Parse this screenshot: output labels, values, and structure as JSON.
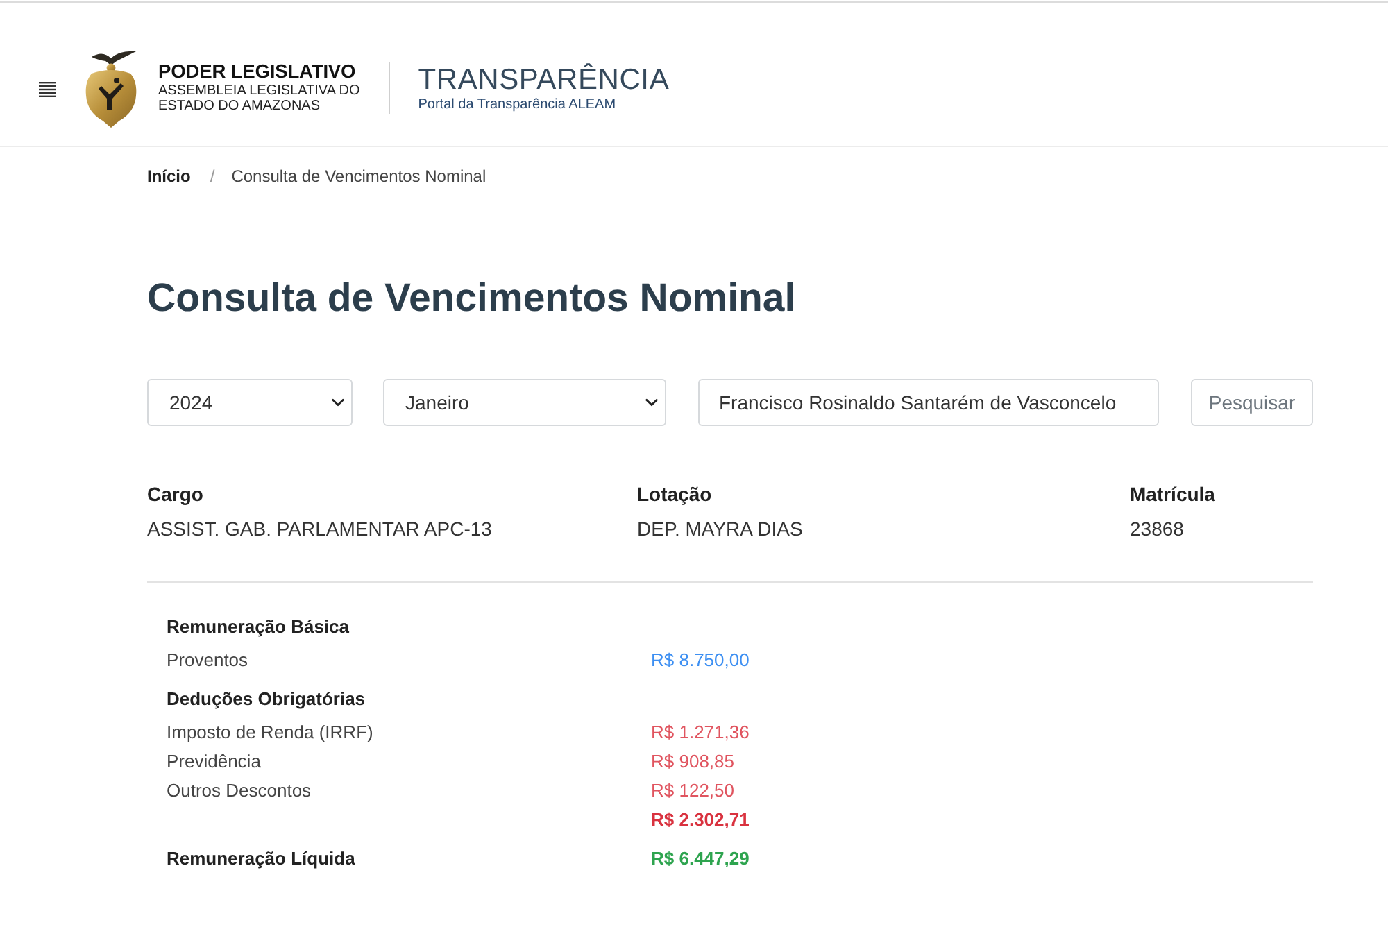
{
  "header": {
    "brand": {
      "title": "PODER LEGISLATIVO",
      "subtitle_lines": [
        "ASSEMBLEIA LEGISLATIVA DO",
        "ESTADO DO AMAZONAS"
      ]
    },
    "portal": {
      "title": "TRANSPARÊNCIA",
      "subtitle": "Portal da Transparência ALEAM"
    }
  },
  "breadcrumb": {
    "separator": "/",
    "items": [
      {
        "label": "Início",
        "current": false
      },
      {
        "label": "Consulta de Vencimentos Nominal",
        "current": true
      }
    ]
  },
  "page_title": "Consulta de Vencimentos Nominal",
  "filters": {
    "year": {
      "value": "2024"
    },
    "month": {
      "value": "Janeiro"
    },
    "employee_name": {
      "value": "Francisco Rosinaldo Santarém de Vasconcelo"
    },
    "search_button": "Pesquisar"
  },
  "details": [
    {
      "label": "Cargo",
      "value": "ASSIST. GAB. PARLAMENTAR APC-13"
    },
    {
      "label": "Lotação",
      "value": "DEP. MAYRA DIAS"
    },
    {
      "label": "Matrícula",
      "value": "23868"
    }
  ],
  "summary": {
    "rows": [
      {
        "kind": "section",
        "label": "Remuneração Básica"
      },
      {
        "kind": "earning",
        "label": "Proventos",
        "value": "R$ 8.750,00"
      },
      {
        "kind": "section",
        "label": "Deduções Obrigatórias"
      },
      {
        "kind": "deduction",
        "label": "Imposto de Renda (IRRF)",
        "value": "R$ 1.271,36"
      },
      {
        "kind": "deduction",
        "label": "Previdência",
        "value": "R$ 908,85"
      },
      {
        "kind": "deduction",
        "label": "Outros Descontos",
        "value": "R$ 122,50"
      },
      {
        "kind": "deduction_total",
        "value": "R$ 2.302,71"
      },
      {
        "kind": "net",
        "label": "Remuneração Líquida",
        "value": "R$ 6.447,29"
      }
    ]
  }
}
